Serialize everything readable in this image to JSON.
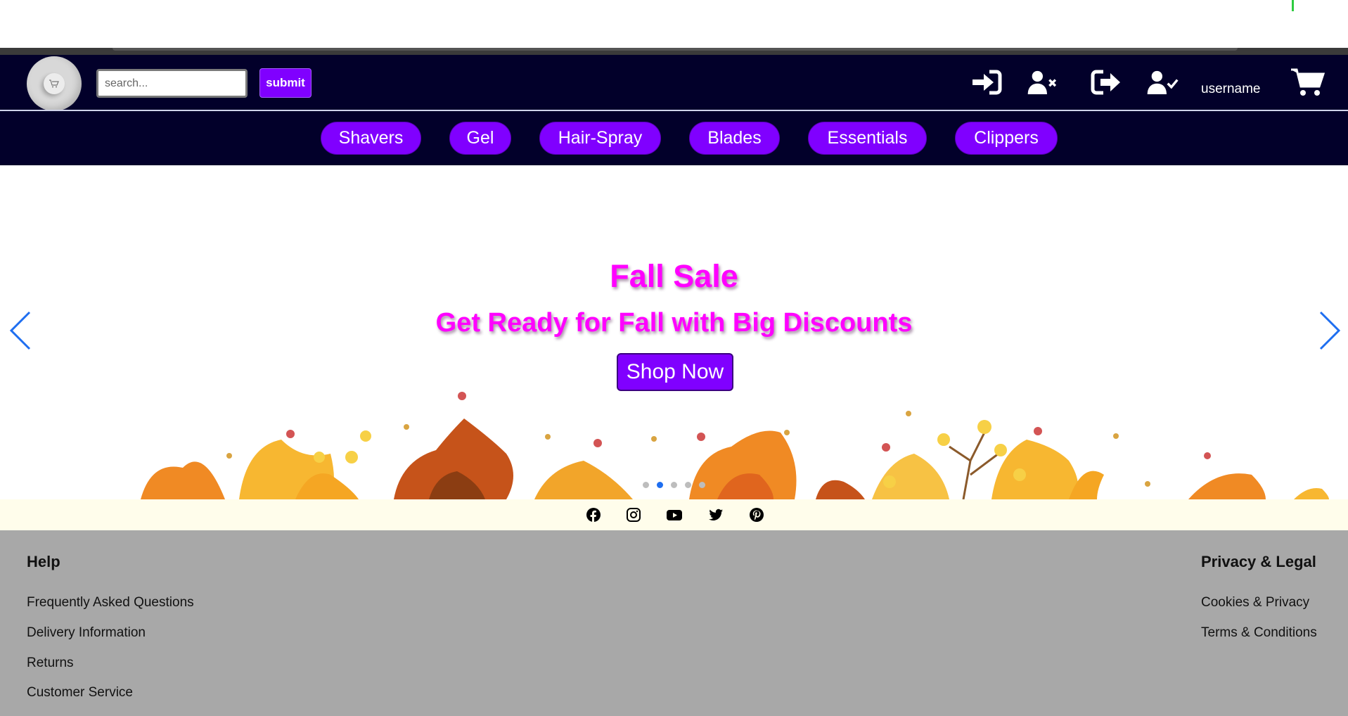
{
  "header": {
    "search_placeholder": "search...",
    "submit_label": "submit",
    "username": "username"
  },
  "categories": [
    "Shavers",
    "Gel",
    "Hair-Spray",
    "Blades",
    "Essentials",
    "Clippers"
  ],
  "hero": {
    "title": "Fall Sale",
    "subtitle": "Get Ready for Fall with Big Discounts",
    "button": "Shop Now",
    "slide_count": 5,
    "active_slide": 2
  },
  "social": [
    "facebook-icon",
    "instagram-icon",
    "youtube-icon",
    "twitter-icon",
    "pinterest-icon"
  ],
  "footer": {
    "help": {
      "heading": "Help",
      "links": [
        "Frequently Asked Questions",
        "Delivery Information",
        "Returns",
        "Customer Service"
      ]
    },
    "legal": {
      "heading": "Privacy & Legal",
      "links": [
        "Cookies & Privacy",
        "Terms & Conditions"
      ]
    }
  },
  "colors": {
    "navy": "#02002a",
    "purple": "#8000ff",
    "magenta": "#ff00ff",
    "footer_gray": "#a8a8a8",
    "arrow_blue": "#1e6ef0"
  }
}
